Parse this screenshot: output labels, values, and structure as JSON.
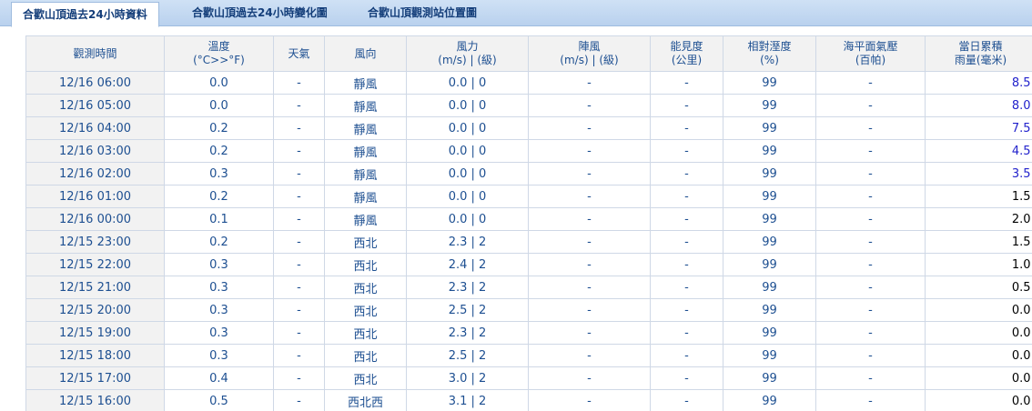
{
  "tabs": [
    {
      "label": "合歡山頂過去24小時資料",
      "active": true
    },
    {
      "label": "合歡山頂過去24小時變化圖",
      "active": false
    },
    {
      "label": "合歡山頂觀測站位置圖",
      "active": false
    }
  ],
  "columns": [
    {
      "key": "time",
      "line1": "觀測時間",
      "line2": ""
    },
    {
      "key": "temp",
      "line1": "溫度",
      "line2": "(°C>>°F)"
    },
    {
      "key": "weather",
      "line1": "天氣",
      "line2": ""
    },
    {
      "key": "wind_dir",
      "line1": "風向",
      "line2": ""
    },
    {
      "key": "wind_force",
      "line1": "風力",
      "line2": "(m/s) | (級)"
    },
    {
      "key": "gust",
      "line1": "陣風",
      "line2": "(m/s) | (級)"
    },
    {
      "key": "visibility",
      "line1": "能見度",
      "line2": "(公里)"
    },
    {
      "key": "humidity",
      "line1": "相對溼度",
      "line2": "(%)"
    },
    {
      "key": "pressure",
      "line1": "海平面氣壓",
      "line2": "(百帕)"
    },
    {
      "key": "rain",
      "line1": "當日累積",
      "line2": "雨量(毫米)"
    }
  ],
  "rows": [
    {
      "time": "12/16 06:00",
      "temp": "0.0",
      "weather": "-",
      "wind_dir": "靜風",
      "wind_force": "0.0 | 0",
      "gust": "-",
      "visibility": "-",
      "humidity": "99",
      "pressure": "-",
      "rain": "8.5"
    },
    {
      "time": "12/16 05:00",
      "temp": "0.0",
      "weather": "-",
      "wind_dir": "靜風",
      "wind_force": "0.0 | 0",
      "gust": "-",
      "visibility": "-",
      "humidity": "99",
      "pressure": "-",
      "rain": "8.0"
    },
    {
      "time": "12/16 04:00",
      "temp": "0.2",
      "weather": "-",
      "wind_dir": "靜風",
      "wind_force": "0.0 | 0",
      "gust": "-",
      "visibility": "-",
      "humidity": "99",
      "pressure": "-",
      "rain": "7.5"
    },
    {
      "time": "12/16 03:00",
      "temp": "0.2",
      "weather": "-",
      "wind_dir": "靜風",
      "wind_force": "0.0 | 0",
      "gust": "-",
      "visibility": "-",
      "humidity": "99",
      "pressure": "-",
      "rain": "4.5"
    },
    {
      "time": "12/16 02:00",
      "temp": "0.3",
      "weather": "-",
      "wind_dir": "靜風",
      "wind_force": "0.0 | 0",
      "gust": "-",
      "visibility": "-",
      "humidity": "99",
      "pressure": "-",
      "rain": "3.5"
    },
    {
      "time": "12/16 01:00",
      "temp": "0.2",
      "weather": "-",
      "wind_dir": "靜風",
      "wind_force": "0.0 | 0",
      "gust": "-",
      "visibility": "-",
      "humidity": "99",
      "pressure": "-",
      "rain": "1.5"
    },
    {
      "time": "12/16 00:00",
      "temp": "0.1",
      "weather": "-",
      "wind_dir": "靜風",
      "wind_force": "0.0 | 0",
      "gust": "-",
      "visibility": "-",
      "humidity": "99",
      "pressure": "-",
      "rain": "2.0"
    },
    {
      "time": "12/15 23:00",
      "temp": "0.2",
      "weather": "-",
      "wind_dir": "西北",
      "wind_force": "2.3 | 2",
      "gust": "-",
      "visibility": "-",
      "humidity": "99",
      "pressure": "-",
      "rain": "1.5"
    },
    {
      "time": "12/15 22:00",
      "temp": "0.3",
      "weather": "-",
      "wind_dir": "西北",
      "wind_force": "2.4 | 2",
      "gust": "-",
      "visibility": "-",
      "humidity": "99",
      "pressure": "-",
      "rain": "1.0"
    },
    {
      "time": "12/15 21:00",
      "temp": "0.3",
      "weather": "-",
      "wind_dir": "西北",
      "wind_force": "2.3 | 2",
      "gust": "-",
      "visibility": "-",
      "humidity": "99",
      "pressure": "-",
      "rain": "0.5"
    },
    {
      "time": "12/15 20:00",
      "temp": "0.3",
      "weather": "-",
      "wind_dir": "西北",
      "wind_force": "2.5 | 2",
      "gust": "-",
      "visibility": "-",
      "humidity": "99",
      "pressure": "-",
      "rain": "0.0"
    },
    {
      "time": "12/15 19:00",
      "temp": "0.3",
      "weather": "-",
      "wind_dir": "西北",
      "wind_force": "2.3 | 2",
      "gust": "-",
      "visibility": "-",
      "humidity": "99",
      "pressure": "-",
      "rain": "0.0"
    },
    {
      "time": "12/15 18:00",
      "temp": "0.3",
      "weather": "-",
      "wind_dir": "西北",
      "wind_force": "2.5 | 2",
      "gust": "-",
      "visibility": "-",
      "humidity": "99",
      "pressure": "-",
      "rain": "0.0"
    },
    {
      "time": "12/15 17:00",
      "temp": "0.4",
      "weather": "-",
      "wind_dir": "西北",
      "wind_force": "3.0 | 2",
      "gust": "-",
      "visibility": "-",
      "humidity": "99",
      "pressure": "-",
      "rain": "0.0"
    },
    {
      "time": "12/15 16:00",
      "temp": "0.5",
      "weather": "-",
      "wind_dir": "西北西",
      "wind_force": "3.1 | 2",
      "gust": "-",
      "visibility": "-",
      "humidity": "99",
      "pressure": "-",
      "rain": "0.0"
    }
  ]
}
